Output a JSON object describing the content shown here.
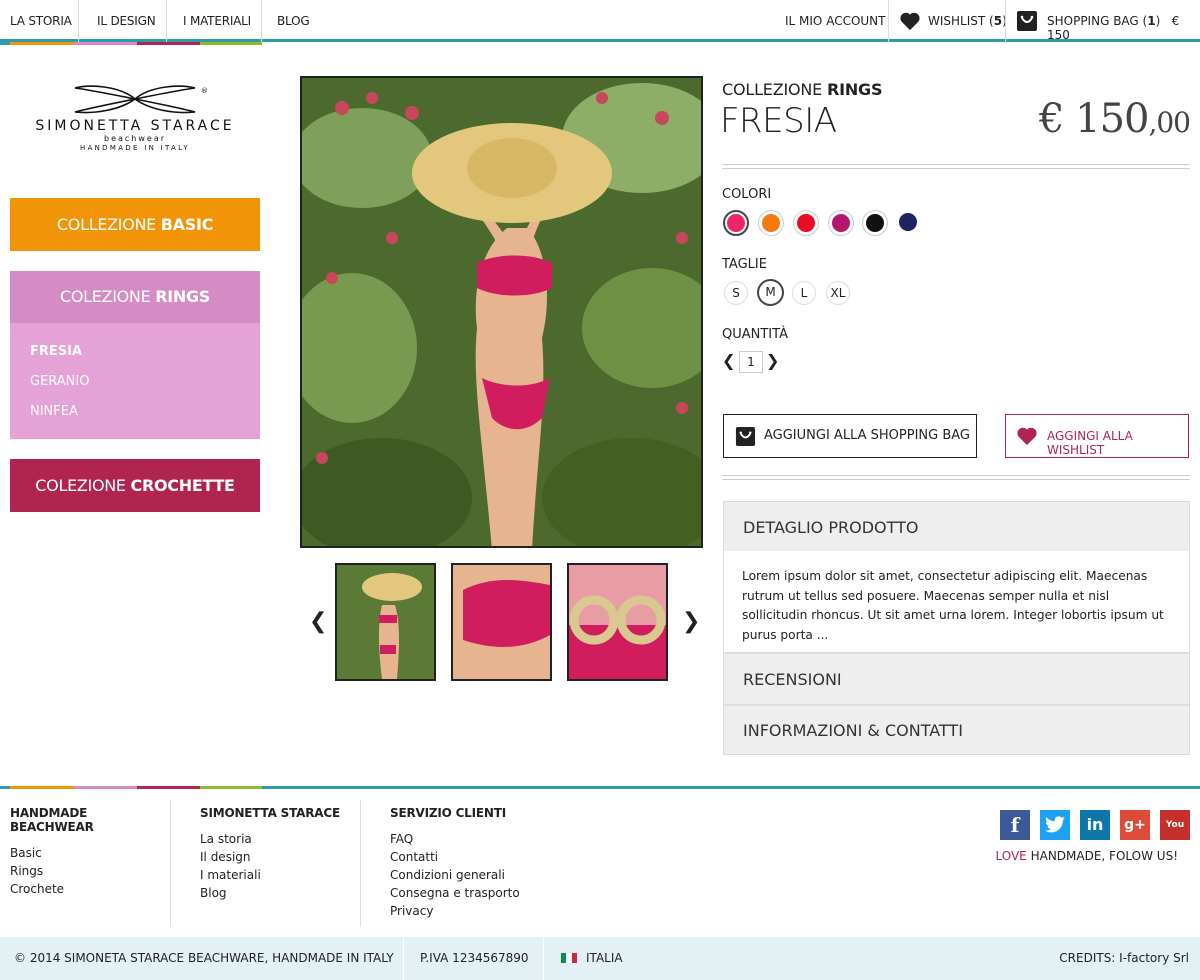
{
  "topnav": {
    "items": [
      "LA STORIA",
      "IL DESIGN",
      "I MATERIALI",
      "BLOG"
    ]
  },
  "account": {
    "my_account": "IL MIO ACCOUNT",
    "wishlist": "WISHLIST",
    "wishlist_count": "5",
    "bag": "SHOPPING BAG",
    "bag_count": "1",
    "bag_total": "€ 150"
  },
  "stripe_colors": [
    "#f29408",
    "#d58cc4",
    "#b0254f",
    "#8dbb2b"
  ],
  "logo": {
    "name": "SIMONETTA STARACE",
    "sub": "beachwear",
    "tagline": "HANDMADE IN ITALY",
    "reg": "®"
  },
  "sidebar": {
    "basic": {
      "prefix": "COLLEZIONE ",
      "bold": "BASIC"
    },
    "rings": {
      "prefix": "COLEZIONE ",
      "bold": "RINGS",
      "items": [
        "FRESIA",
        "GERANIO",
        "NINFEA"
      ]
    },
    "crochette": {
      "prefix": "COLEZIONE ",
      "bold": "CROCHETTE"
    }
  },
  "product": {
    "collection_prefix": "COLLEZIONE ",
    "collection_bold": "RINGS",
    "name": "FRESIA",
    "price_main": "€ 150",
    "price_cents": ",00",
    "colors_label": "COLORI",
    "colors": [
      "#f0236a",
      "#f57a09",
      "#ec0b23",
      "#b5176c",
      "#111111",
      "#1d2360"
    ],
    "sizes_label": "TAGLIE",
    "sizes": [
      "S",
      "M",
      "L",
      "XL"
    ],
    "selected_size": "M",
    "qty_label": "QUANTITÀ",
    "qty": "1",
    "add_bag": "AGGIUNGI ALLA SHOPPING BAG",
    "add_wish": "AGGINGI ALLA WISHLIST"
  },
  "accordion": {
    "detail": "DETAGLIO PRODOTTO",
    "detail_body": "Lorem ipsum dolor sit amet, consectetur adipiscing elit. Maecenas rutrum ut tellus sed posuere. Maecenas semper nulla et nisl sollicitudin rhoncus. Ut sit amet urna lorem. Integer lobortis ipsum ut purus porta ...",
    "reviews": "RECENSIONI",
    "info": "INFORMAZIONI & CONTATTI"
  },
  "footer": {
    "col1": {
      "title": "HANDMADE BEACHWEAR",
      "links": [
        "Basic",
        "Rings",
        "Crochete"
      ]
    },
    "col2": {
      "title": "SIMONETTA STARACE",
      "links": [
        "La storia",
        "Il design",
        "I materiali",
        "Blog"
      ]
    },
    "col3": {
      "title": "SERVIZIO CLIENTI",
      "links": [
        "FAQ",
        "Contatti",
        "Condizioni generali",
        "Consegna e trasporto",
        "Privacy"
      ]
    },
    "social": [
      "f",
      "t",
      "in",
      "g+",
      "You"
    ],
    "follow_love": "LOVE",
    "follow_rest": " HANDMADE, FOLOW US!"
  },
  "bottom": {
    "copyright": "© 2014 SIMONETA STARACE BEACHWARE, HANDMADE IN ITALY",
    "piva": "P.IVA 1234567890",
    "country": "ITALIA",
    "credits": "CREDITS: I-factory Srl"
  }
}
